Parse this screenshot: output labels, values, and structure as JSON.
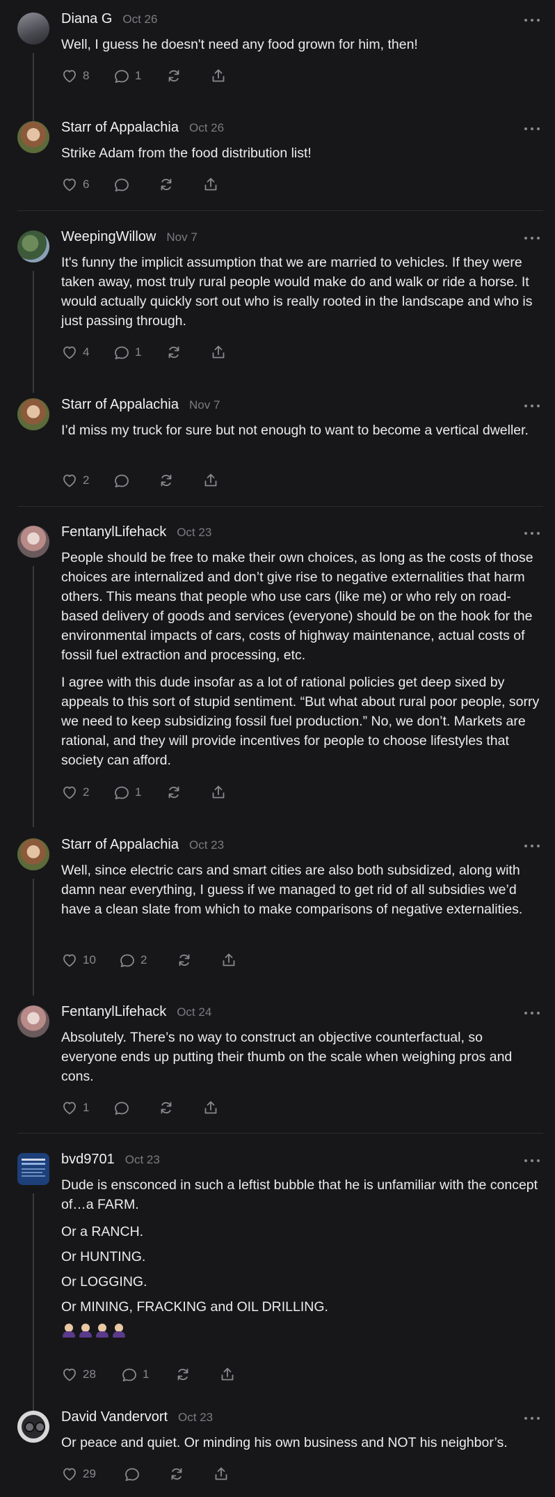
{
  "colors": {
    "background": "#171719",
    "text": "#ececec",
    "muted": "#8a8a8e",
    "thread": "#3a3a3d"
  },
  "comments": [
    {
      "author": "Diana G",
      "date": "Oct 26",
      "paragraphs": [
        "Well, I guess he doesn't need any food grown for him, then!"
      ],
      "likes": "8",
      "replies": "1"
    },
    {
      "author": "Starr of Appalachia",
      "date": "Oct 26",
      "paragraphs": [
        "Strike Adam from the food distribution list!"
      ],
      "likes": "6",
      "replies": ""
    },
    {
      "author": "WeepingWillow",
      "date": "Nov 7",
      "paragraphs": [
        "It's funny the implicit assumption that we are married to vehicles. If they were taken away, most truly rural people would make do and walk or ride a horse. It would actually quickly sort out who is really rooted in the landscape and who is just passing through."
      ],
      "likes": "4",
      "replies": "1"
    },
    {
      "author": "Starr of Appalachia",
      "date": "Nov 7",
      "paragraphs": [
        "I’d miss my truck for sure but not enough to want to become a vertical dweller."
      ],
      "likes": "2",
      "replies": ""
    },
    {
      "author": "FentanylLifehack",
      "date": "Oct 23",
      "paragraphs": [
        "People should be free to make their own choices, as long as the costs of those choices are internalized and don’t give rise to negative externalities that harm others. This means that people who use cars (like me) or who rely on road-based delivery of goods and services (everyone) should be on the hook for the environmental impacts of cars, costs of highway maintenance, actual costs of fossil fuel extraction and processing, etc.",
        "I agree with this dude insofar as a lot of rational policies get deep sixed by appeals to this sort of stupid sentiment. “But what about rural poor people, sorry we need to keep subsidizing fossil fuel production.” No, we don’t. Markets are rational, and they will provide incentives for people to choose lifestyles that society can afford."
      ],
      "likes": "2",
      "replies": "1"
    },
    {
      "author": "Starr of Appalachia",
      "date": "Oct 23",
      "paragraphs": [
        "Well, since electric cars and smart cities are also both subsidized, along with damn near everything, I guess if we managed to get rid of all subsidies we’d have a clean slate from which to make comparisons of negative externalities."
      ],
      "likes": "10",
      "replies": "2"
    },
    {
      "author": "FentanylLifehack",
      "date": "Oct 24",
      "paragraphs": [
        "Absolutely. There’s no way to construct an objective counterfactual, so everyone ends up putting their thumb on the scale when weighing pros and cons."
      ],
      "likes": "1",
      "replies": ""
    },
    {
      "author": "bvd9701",
      "date": "Oct 23",
      "paragraphs": [
        "Dude is ensconced in such a leftist bubble that he is unfamiliar with the concept of…a FARM.",
        "Or a RANCH.",
        "Or HUNTING.",
        "Or LOGGING.",
        "Or MINING, FRACKING and OIL DRILLING."
      ],
      "emoji": [
        "person-emoji",
        "person-emoji",
        "person-emoji",
        "person-emoji"
      ],
      "likes": "28",
      "replies": "1"
    },
    {
      "author": "David Vandervort",
      "date": "Oct 23",
      "paragraphs": [
        "Or peace and quiet. Or minding his own business and NOT his neighbor’s."
      ],
      "likes": "29",
      "replies": ""
    }
  ]
}
